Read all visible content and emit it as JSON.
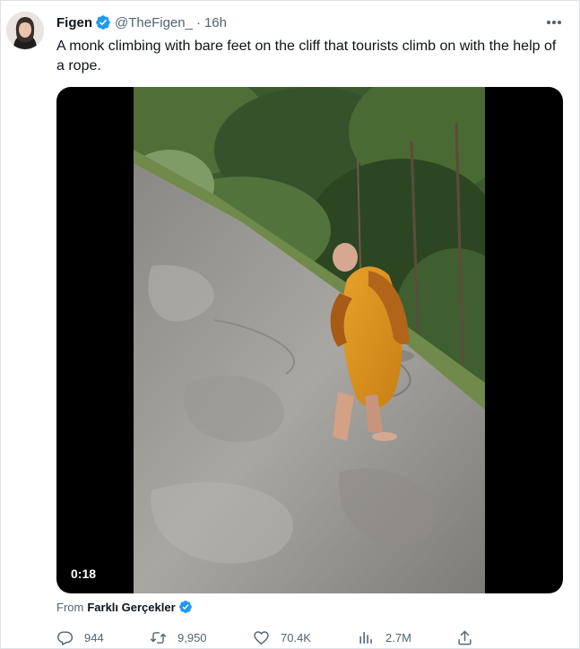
{
  "tweet": {
    "author_name": "Figen",
    "handle": "@TheFigen_",
    "separator": "·",
    "time": "16h",
    "text": "A monk climbing with bare feet on the cliff that tourists climb on with the help of a rope.",
    "verified": true
  },
  "media": {
    "type": "video",
    "duration": "0:18"
  },
  "source": {
    "prefix": "From",
    "name": "Farklı Gerçekler",
    "verified": true
  },
  "actions": {
    "replies": "944",
    "retweets": "9,950",
    "likes": "70.4K",
    "views": "2.7M"
  },
  "icons": {
    "verified": "verified-badge-icon",
    "more": "more-icon",
    "reply": "reply-icon",
    "retweet": "retweet-icon",
    "like": "heart-icon",
    "views": "views-icon",
    "share": "share-icon"
  },
  "colors": {
    "verified_blue": "#1d9bf0",
    "text_primary": "#0f1419",
    "text_secondary": "#536471"
  }
}
